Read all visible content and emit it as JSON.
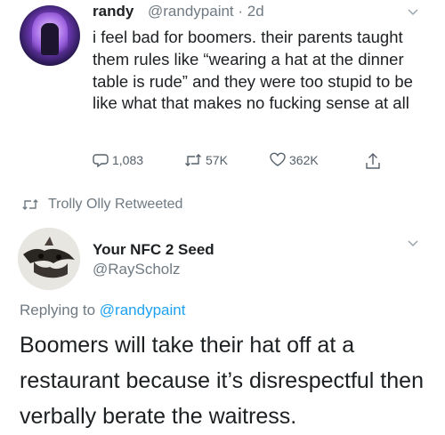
{
  "tweet1": {
    "name": "randy",
    "handle_time": "@randypaint · 2d",
    "text": "i feel bad for boomers. their parents taught them rules like “wearing a hat at the dinner table is rude” and they were too stupid to be like what that makes no fucking sense at all",
    "stats": {
      "replies": "1,083",
      "retweets": "57K",
      "likes": "362K"
    }
  },
  "retweet_banner": "Trolly Olly Retweeted",
  "tweet2": {
    "name": "Your NFC 2 Seed",
    "handle": "@RayScholz",
    "replying_prefix": "Replying to ",
    "replying_to": "@randypaint",
    "text": "Boomers will take their hat off at a restaurant because it’s disrespectful then verbally berate the waitress."
  },
  "colors": {
    "link": "#1da1f2",
    "muted": "#6f7a83",
    "text": "#1c2022"
  }
}
